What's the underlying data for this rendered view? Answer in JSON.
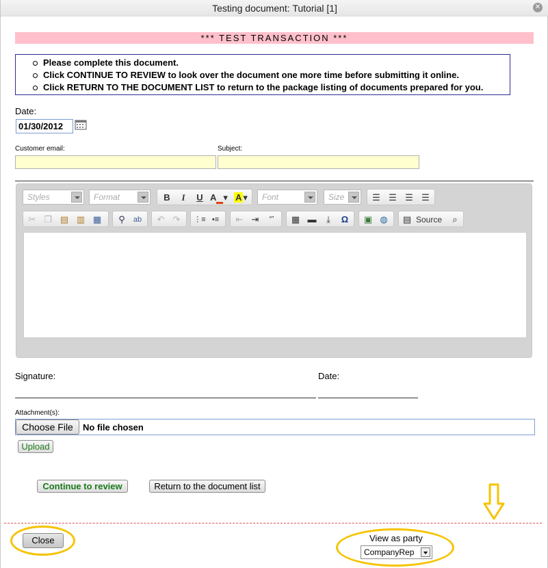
{
  "window": {
    "title": "Testing document: Tutorial [1]",
    "close_glyph": "✕"
  },
  "banner": "*** TEST TRANSACTION ***",
  "instructions": [
    "Please complete this document.",
    "Click CONTINUE TO REVIEW to look over the document one more time before submitting it online.",
    "Click RETURN TO THE DOCUMENT LIST to return to the package listing of documents prepared for you."
  ],
  "form": {
    "date_label": "Date:",
    "date_value": "01/30/2012",
    "customer_email_label": "Customer email:",
    "subject_label": "Subject:",
    "signature_label": "Signature:",
    "signature_date_label": "Date:",
    "attachments_label": "Attachment(s):",
    "choose_file_label": "Choose File",
    "no_file_text": "No file chosen",
    "upload_label": "Upload"
  },
  "editor": {
    "styles_placeholder": "Styles",
    "format_placeholder": "Format",
    "font_placeholder": "Font",
    "size_placeholder": "Size",
    "bold": "B",
    "italic": "I",
    "underline": "U",
    "source_label": "Source"
  },
  "actions": {
    "continue_label": "Continue to review",
    "return_label": "Return to the document list"
  },
  "footer": {
    "close_label": "Close",
    "view_as_party_label": "View as party",
    "party_value": "CompanyRep"
  },
  "colors": {
    "banner_bg": "#ffc0cb",
    "field_bg": "#ffffd0",
    "highlight": "#f5c300",
    "green_text": "#1a7a1a"
  }
}
